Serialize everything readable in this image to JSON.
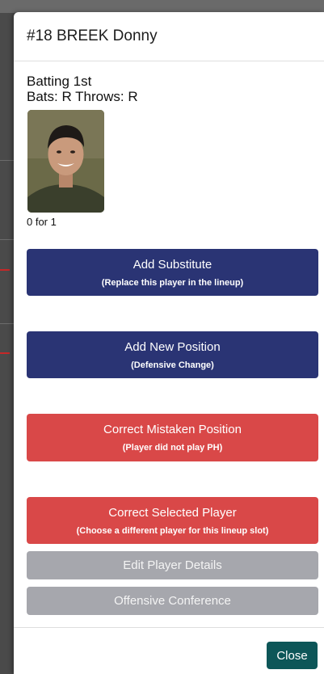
{
  "modal": {
    "title": "#18 BREEK Donny",
    "batting_order": "Batting 1st",
    "handedness": "Bats: R Throws: R",
    "stat_line": "0 for 1"
  },
  "actions": {
    "add_substitute": {
      "label": "Add Substitute",
      "sub": "(Replace this player in the lineup)"
    },
    "add_new_position": {
      "label": "Add New Position",
      "sub": "(Defensive Change)"
    },
    "correct_mistaken_position": {
      "label": "Correct Mistaken Position",
      "sub": "(Player did not play PH)"
    },
    "correct_selected_player": {
      "label": "Correct Selected Player",
      "sub": "(Choose a different player for this lineup slot)"
    },
    "edit_player_details": {
      "label": "Edit Player Details"
    },
    "offensive_conference": {
      "label": "Offensive Conference"
    }
  },
  "footer": {
    "close_label": "Close"
  },
  "colors": {
    "primary": "#2a3474",
    "danger": "#d94848",
    "secondary": "#a6a7ad",
    "close": "#0d5658"
  }
}
